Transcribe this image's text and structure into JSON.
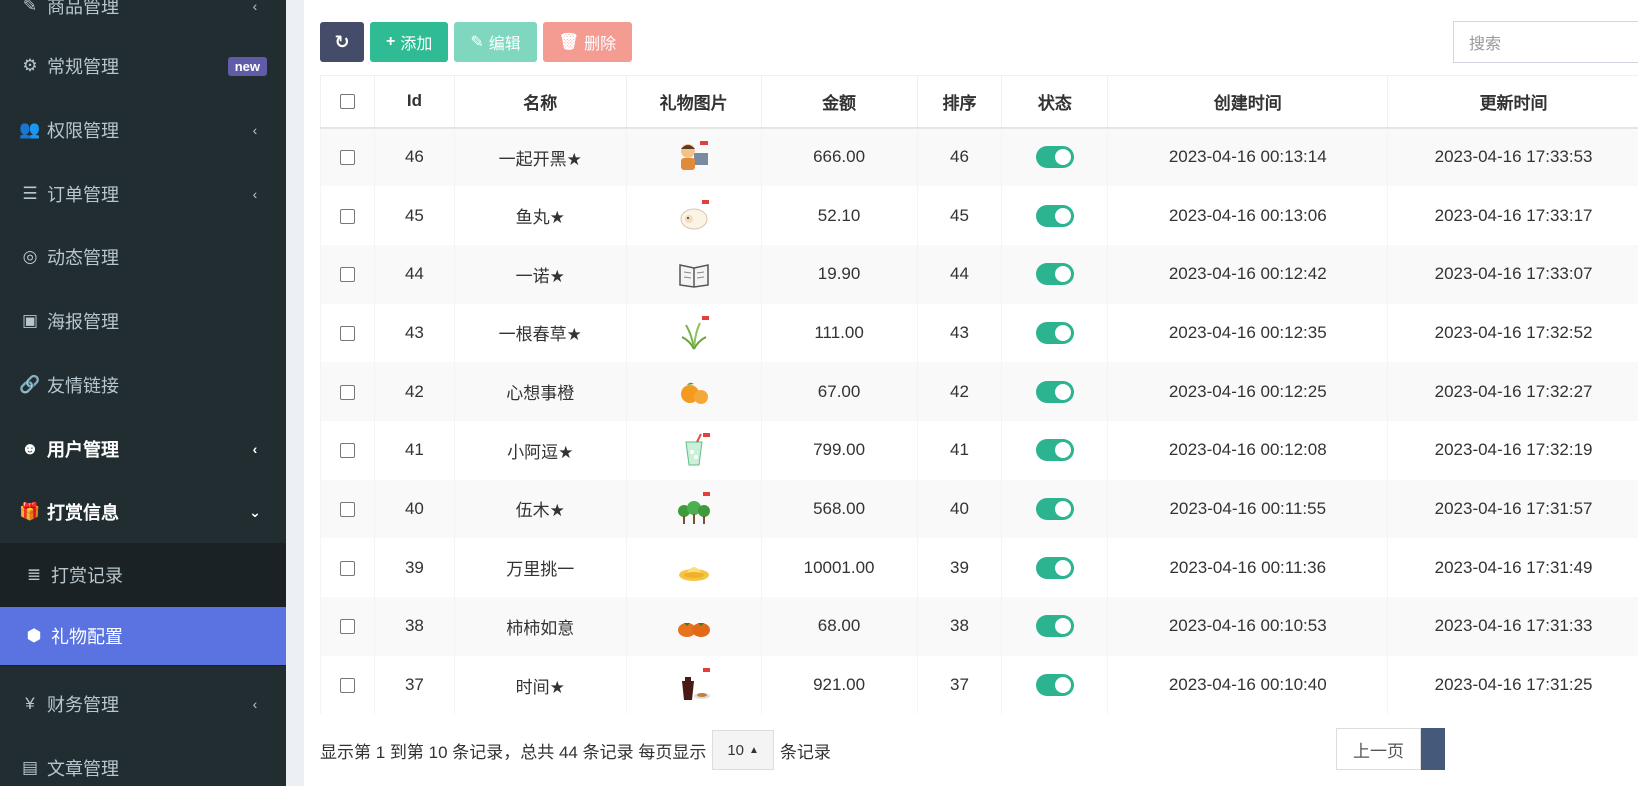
{
  "sidebar": {
    "items": [
      {
        "label": "商品管理",
        "icon": "edit-icon",
        "glyph": "✎"
      },
      {
        "label": "常规管理",
        "icon": "cogs-icon",
        "glyph": "⚙",
        "badge": "new"
      },
      {
        "label": "权限管理",
        "icon": "users-icon",
        "glyph": "👥"
      },
      {
        "label": "订单管理",
        "icon": "list-icon",
        "glyph": "☰"
      },
      {
        "label": "动态管理",
        "icon": "binoculars-icon",
        "glyph": "◎"
      },
      {
        "label": "海报管理",
        "icon": "image-icon",
        "glyph": "▣"
      },
      {
        "label": "友情链接",
        "icon": "link-icon",
        "glyph": "🔗"
      },
      {
        "label": "用户管理",
        "icon": "user-circle-icon",
        "glyph": "☻"
      },
      {
        "label": "打赏信息",
        "icon": "gift-icon",
        "glyph": "🎁"
      },
      {
        "label": "打赏记录",
        "icon": "bars-icon",
        "glyph": "≣"
      },
      {
        "label": "礼物配置",
        "icon": "cube-icon",
        "glyph": "⬢"
      },
      {
        "label": "财务管理",
        "icon": "yen-icon",
        "glyph": "¥"
      },
      {
        "label": "文章管理",
        "icon": "document-icon",
        "glyph": "▤"
      }
    ]
  },
  "toolbar": {
    "add_label": "添加",
    "edit_label": "编辑",
    "delete_label": "删除"
  },
  "search": {
    "placeholder": "搜索"
  },
  "table": {
    "headers": [
      "Id",
      "名称",
      "礼物图片",
      "金额",
      "排序",
      "状态",
      "创建时间",
      "更新时间"
    ],
    "rows": [
      {
        "id": "46",
        "name": "一起开黑★",
        "image": "gamer-icon",
        "amount": "666.00",
        "sort": "46",
        "status": true,
        "created": "2023-04-16 00:13:14",
        "updated": "2023-04-16 17:33:53"
      },
      {
        "id": "45",
        "name": "鱼丸★",
        "image": "sheep-icon",
        "amount": "52.10",
        "sort": "45",
        "status": true,
        "created": "2023-04-16 00:13:06",
        "updated": "2023-04-16 17:33:17"
      },
      {
        "id": "44",
        "name": "一诺★",
        "image": "book-icon",
        "amount": "19.90",
        "sort": "44",
        "status": true,
        "created": "2023-04-16 00:12:42",
        "updated": "2023-04-16 17:33:07"
      },
      {
        "id": "43",
        "name": "一根春草★",
        "image": "grass-icon",
        "amount": "111.00",
        "sort": "43",
        "status": true,
        "created": "2023-04-16 00:12:35",
        "updated": "2023-04-16 17:32:52"
      },
      {
        "id": "42",
        "name": "心想事橙",
        "image": "orange-icon",
        "amount": "67.00",
        "sort": "42",
        "status": true,
        "created": "2023-04-16 00:12:25",
        "updated": "2023-04-16 17:32:27"
      },
      {
        "id": "41",
        "name": "小阿逗★",
        "image": "drink-icon",
        "amount": "799.00",
        "sort": "41",
        "status": true,
        "created": "2023-04-16 00:12:08",
        "updated": "2023-04-16 17:32:19"
      },
      {
        "id": "40",
        "name": "伍木★",
        "image": "trees-icon",
        "amount": "568.00",
        "sort": "40",
        "status": true,
        "created": "2023-04-16 00:11:55",
        "updated": "2023-04-16 17:31:57"
      },
      {
        "id": "39",
        "name": "万里挑一",
        "image": "gold-ingot-icon",
        "amount": "10001.00",
        "sort": "39",
        "status": true,
        "created": "2023-04-16 00:11:36",
        "updated": "2023-04-16 17:31:49"
      },
      {
        "id": "38",
        "name": "柿柿如意",
        "image": "persimmon-icon",
        "amount": "68.00",
        "sort": "38",
        "status": true,
        "created": "2023-04-16 00:10:53",
        "updated": "2023-04-16 17:31:33"
      },
      {
        "id": "37",
        "name": "时间★",
        "image": "tea-icon",
        "amount": "921.00",
        "sort": "37",
        "status": true,
        "created": "2023-04-16 00:10:40",
        "updated": "2023-04-16 17:31:25"
      }
    ]
  },
  "footer": {
    "summary": "显示第 1 到第 10 条记录，总共 44 条记录 每页显示",
    "page_size": "10",
    "suffix": "条记录",
    "prev_label": "上一页"
  }
}
